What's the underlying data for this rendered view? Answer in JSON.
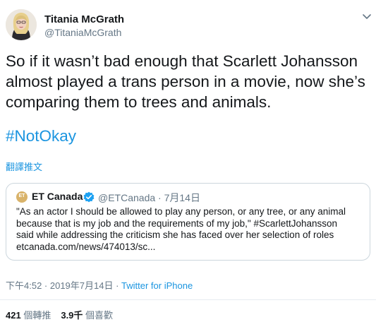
{
  "author": {
    "name": "Titania McGrath",
    "handle": "@TitaniaMcGrath"
  },
  "tweet": {
    "text": "So if it wasn’t bad enough that Scarlett Johansson almost played a trans person in a movie, now she’s comparing them to trees and animals.",
    "hashtag": "#NotOkay",
    "translate_label": "翻譯推文"
  },
  "quoted_tweet": {
    "avatar_text": "ET",
    "name": "ET Canada",
    "handle_date": "@ETCanada · 7月14日",
    "lines": [
      "\"As an actor I should be allowed to play any person, or any tree, or any animal",
      "because that is my job and the requirements of my job,\" #ScarlettJohansson",
      "said while addressing the criticism she has faced over her selection of roles",
      "etcanada.com/news/474013/sc..."
    ]
  },
  "meta": {
    "timestamp": "下午4:52 · 2019年7月14日 · ",
    "source": "Twitter for iPhone"
  },
  "stats": {
    "retweets_count": "421",
    "retweets_label": "個轉推",
    "likes_count": "3.9千",
    "likes_label": "個喜歡"
  },
  "colors": {
    "link": "#1b95e0",
    "secondary_text": "#657786",
    "border": "#ccd6dd"
  },
  "icons": {
    "caret": "chevron-down-icon",
    "verified": "verified-badge-icon"
  }
}
